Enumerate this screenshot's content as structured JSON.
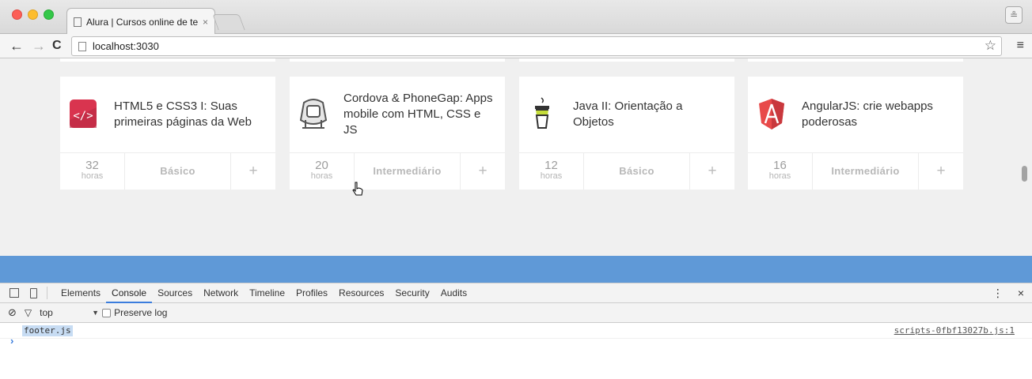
{
  "browser": {
    "tab_title": "Alura | Cursos online de te",
    "tab_close": "×",
    "url": "localhost:3030",
    "back": "←",
    "forward": "→",
    "reload": "C",
    "star": "☆",
    "menu": "≡",
    "profile": "≗"
  },
  "courses": [
    {
      "title": "HTML5 e CSS3 I: Suas primeiras páginas da Web",
      "hours": "32",
      "hours_unit": "horas",
      "level": "Básico",
      "add": "+",
      "icon": "html-code-icon"
    },
    {
      "title": "Cordova & PhoneGap: Apps mobile com HTML, CSS e JS",
      "hours": "20",
      "hours_unit": "horas",
      "level": "Intermediário",
      "add": "+",
      "icon": "phonegap-robot-icon"
    },
    {
      "title": "Java II: Orientação a Objetos",
      "hours": "12",
      "hours_unit": "horas",
      "level": "Básico",
      "add": "+",
      "icon": "java-cup-icon"
    },
    {
      "title": "AngularJS: crie webapps poderosas",
      "hours": "16",
      "hours_unit": "horas",
      "level": "Intermediário",
      "add": "+",
      "icon": "angular-shield-icon"
    }
  ],
  "devtools": {
    "tabs": [
      "Elements",
      "Console",
      "Sources",
      "Network",
      "Timeline",
      "Profiles",
      "Resources",
      "Security",
      "Audits"
    ],
    "active_tab": "Console",
    "more": "⋮",
    "close": "×",
    "context": "top",
    "context_arrow": "▼",
    "preserve_log": "Preserve log",
    "log_message": "footer.js",
    "log_source": "scripts-0fbf13027b.js:1",
    "prompt": "›"
  },
  "colors": {
    "accent_band": "#5f99d7",
    "page_background": "#f0f0f0"
  }
}
